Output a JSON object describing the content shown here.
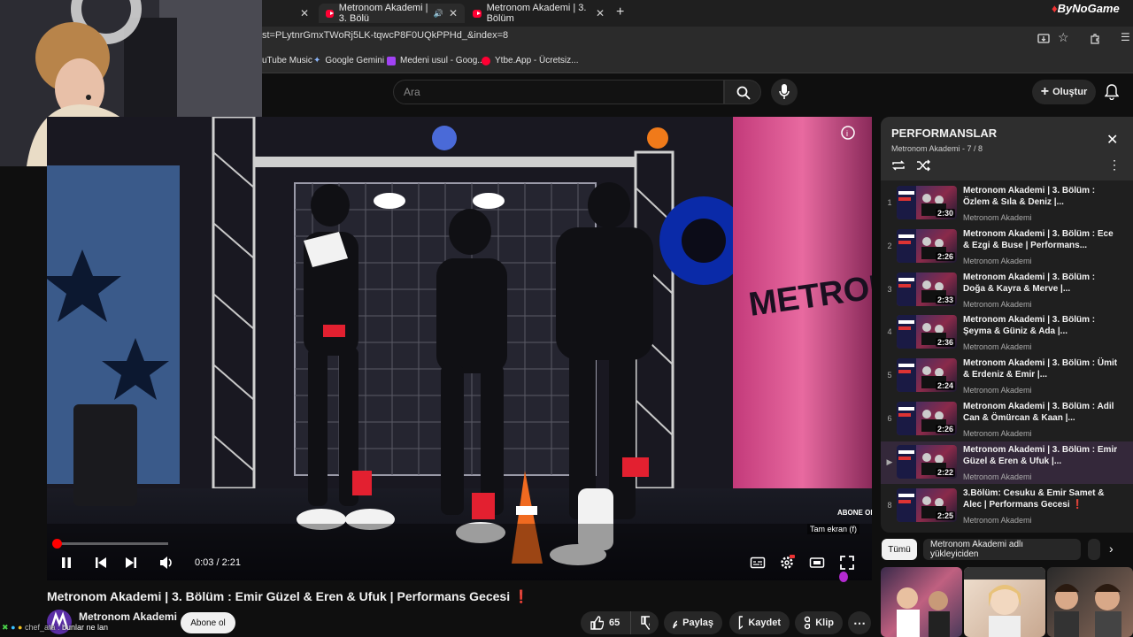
{
  "browser": {
    "tabs": [
      {
        "label": "Metronom Akademi | 3. Bölü",
        "active": true
      },
      {
        "label": "Metronom Akademi | 3. Bölüm",
        "active": false
      }
    ],
    "new_tab": "+",
    "url": "st=PLytnrGmxTWoRj5LK-tqwcP8F0UQkPPHd_&index=8",
    "bookmarks": [
      {
        "label": "uTube Music",
        "color": "#ff0033"
      },
      {
        "label": "Google Gemini",
        "color": "#8ab4f8"
      },
      {
        "label": "Medeni usul - Goog...",
        "color": "#a142f4"
      },
      {
        "label": "Ytbe.App - Ücretsiz...",
        "color": "#ff0033"
      }
    ],
    "watermark": "ByNoGame"
  },
  "youtube": {
    "search_placeholder": "Ara",
    "create_label": "Oluştur"
  },
  "player": {
    "progress": 0.0216,
    "time": "0:03 / 2:21",
    "fullscreen_tooltip": "Tam ekran (f)",
    "stage_sign": "METRONOM",
    "corner_badge": "ABONE OL"
  },
  "video": {
    "title": "Metronom Akademi | 3. Bölüm : Emir Güzel & Eren & Ufuk | Performans Gecesi",
    "title_emoji": "❗",
    "channel": "Metronom Akademi",
    "subscribe_label": "Abone ol",
    "likes": "65",
    "share_label": "Paylaş",
    "save_label": "Kaydet",
    "clip_label": "Klip"
  },
  "chat_overlay": {
    "user": "chef_ata :",
    "message": "bunlar ne lan"
  },
  "playlist": {
    "title": "PERFORMANSLAR",
    "subtitle": "Metronom Akademi - 7 / 8",
    "items": [
      {
        "num": "1",
        "title": "Metronom Akademi | 3. Bölüm : Özlem & Sıla & Deniz |...",
        "channel": "Metronom Akademi",
        "duration": "2:30",
        "current": false
      },
      {
        "num": "2",
        "title": "Metronom Akademi | 3. Bölüm : Ece & Ezgi & Buse | Performans...",
        "channel": "Metronom Akademi",
        "duration": "2:26",
        "current": false
      },
      {
        "num": "3",
        "title": "Metronom Akademi | 3. Bölüm : Doğa & Kayra & Merve |...",
        "channel": "Metronom Akademi",
        "duration": "2:33",
        "current": false
      },
      {
        "num": "4",
        "title": "Metronom Akademi | 3. Bölüm : Şeyma & Güniz & Ada |...",
        "channel": "Metronom Akademi",
        "duration": "2:36",
        "current": false
      },
      {
        "num": "5",
        "title": "Metronom Akademi | 3. Bölüm : Ümit & Erdeniz & Emir |...",
        "channel": "Metronom Akademi",
        "duration": "2:24",
        "current": false
      },
      {
        "num": "6",
        "title": "Metronom Akademi | 3. Bölüm : Adil Can & Ömürcan & Kaan |...",
        "channel": "Metronom Akademi",
        "duration": "2:26",
        "current": false
      },
      {
        "num": "▶",
        "title": "Metronom Akademi | 3. Bölüm : Emir Güzel & Eren & Ufuk |...",
        "channel": "Metronom Akademi",
        "duration": "2:22",
        "current": true
      },
      {
        "num": "8",
        "title": "3.Bölüm: Cesuku & Emir Samet & Alec | Performans Gecesi ❗",
        "channel": "Metronom Akademi",
        "duration": "2:25",
        "current": false
      }
    ]
  },
  "chips": [
    {
      "label": "Tümü",
      "active": true
    },
    {
      "label": "Metronom Akademi adlı yükleyiciden",
      "active": false
    }
  ],
  "colors": {
    "accent": "#ff0000",
    "chip_active": "#f1f1f1"
  }
}
